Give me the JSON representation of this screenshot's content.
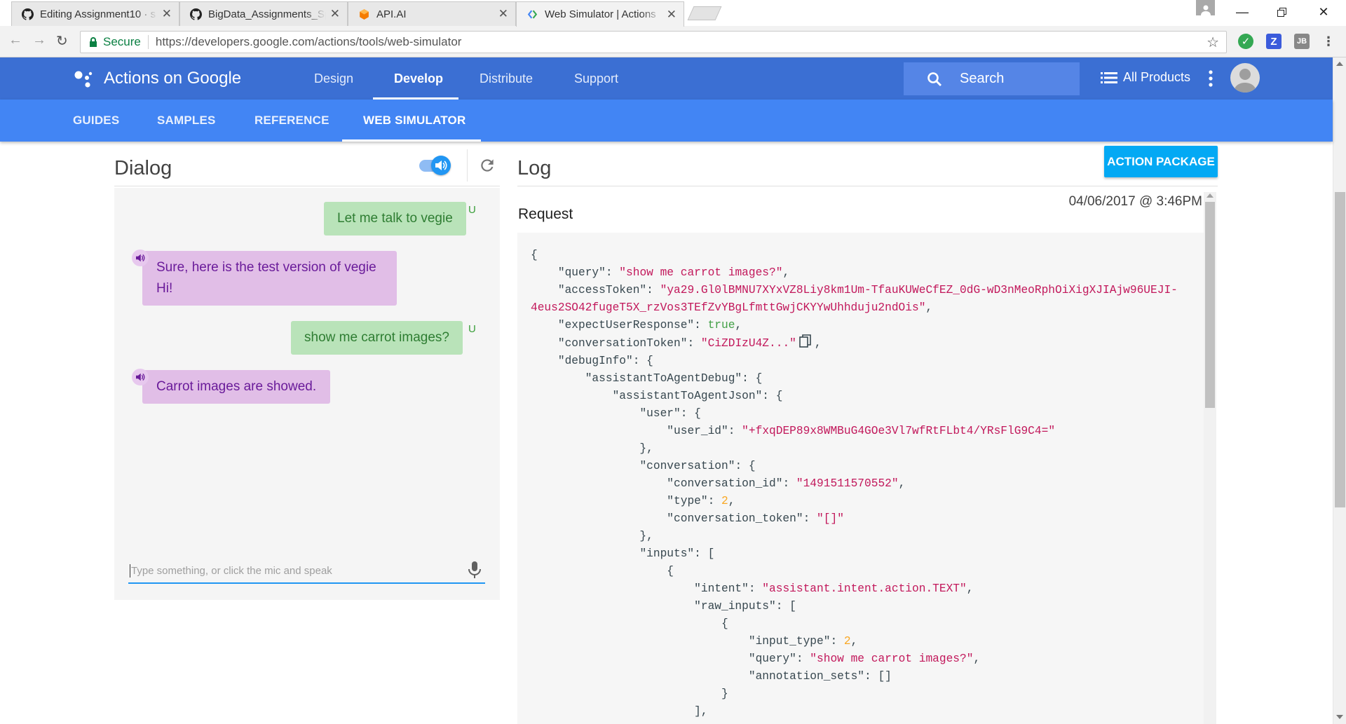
{
  "browser": {
    "tabs": [
      {
        "title": "Editing Assignment10 · s",
        "icon": "github-icon"
      },
      {
        "title": "BigData_Assignments_Sp",
        "icon": "github-icon"
      },
      {
        "title": "API.AI",
        "icon": "apiai-icon"
      },
      {
        "title": "Web Simulator  |  Actions",
        "icon": "google-actions-icon"
      }
    ],
    "secure_label": "Secure",
    "url": "https://developers.google.com/actions/tools/web-simulator"
  },
  "site": {
    "brand": "Actions on Google",
    "nav": [
      "Design",
      "Develop",
      "Distribute",
      "Support"
    ],
    "active_nav": "Develop",
    "search_label": "Search",
    "all_products": "All Products",
    "subnav": [
      "GUIDES",
      "SAMPLES",
      "REFERENCE",
      "WEB SIMULATOR"
    ],
    "active_subnav": "WEB SIMULATOR"
  },
  "dialog": {
    "title": "Dialog",
    "user_badge": "U",
    "messages": [
      {
        "from": "user",
        "text": "Let me talk to vegie"
      },
      {
        "from": "agent",
        "text_line1": "Sure, here is the test version of vegie",
        "text_line2": "Hi!"
      },
      {
        "from": "user",
        "text": "show me carrot images?"
      },
      {
        "from": "agent",
        "text": "Carrot images are showed."
      }
    ],
    "input_placeholder": "Type something, or click the mic and speak"
  },
  "log": {
    "title": "Log",
    "action_package_label": "ACTION PACKAGE",
    "request_label": "Request",
    "timestamp": "04/06/2017 @ 3:46PM",
    "json": {
      "query": "show me carrot images?",
      "accessToken_1": "ya29.Gl0lBMNU7XYxVZ8Liy8km1Um-TfauKUWeCfEZ_0dG-wD3nMeoRphOiXigXJIAjw96UEJI-",
      "accessToken_2": "4eus2SO42fugeT5X_rzVos3TEfZvYBgLfmttGwjCKYYwUhhduju2ndOis",
      "expectUserResponse": "true",
      "conversationToken": "CiZDIzU4Z...",
      "user_id": "+fxqDEP89x8WMBuG4GOe3Vl7wfRtFLbt4/YRsFlG9C4=",
      "conversation_id": "1491511570552",
      "type": "2",
      "conversation_token": "[]",
      "intent": "assistant.intent.action.TEXT",
      "input_type": "2",
      "raw_query": "show me carrot images?",
      "annotation_sets": "[]"
    }
  },
  "colors": {
    "site_header": "#3b6fd3",
    "sub_header": "#4285f4",
    "user_bubble": "#b9e3b9",
    "agent_bubble": "#e1bee7",
    "action_button": "#03a9f4",
    "json_string": "#c2185b",
    "json_number": "#f9a825",
    "json_bool": "#43a047"
  }
}
